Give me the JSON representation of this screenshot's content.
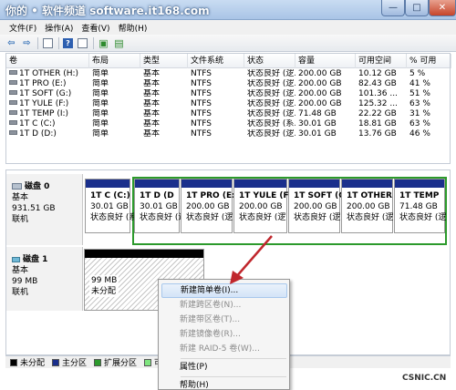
{
  "window": {
    "title": "你的 • 软件频道 software.it168.com",
    "minimize_glyph": "—",
    "maximize_glyph": "□",
    "close_glyph": "✕"
  },
  "menubar": [
    {
      "label": "文件(F)"
    },
    {
      "label": "操作(A)"
    },
    {
      "label": "查看(V)"
    },
    {
      "label": "帮助(H)"
    }
  ],
  "toolbar": {
    "icons": [
      "back-arrow-icon",
      "forward-arrow-icon",
      "console-tree-icon",
      "help-icon",
      "properties-icon",
      "refresh-icon",
      "export-icon"
    ]
  },
  "volume_table": {
    "columns": [
      "卷",
      "布局",
      "类型",
      "文件系统",
      "状态",
      "容量",
      "可用空间",
      "% 可用"
    ],
    "rows": [
      {
        "volume": "1T OTHER (H:)",
        "layout": "简单",
        "type": "基本",
        "fs": "NTFS",
        "status": "状态良好 (逻...",
        "capacity": "200.00 GB",
        "free": "10.12 GB",
        "pct": "5 %"
      },
      {
        "volume": "1T PRO (E:)",
        "layout": "简单",
        "type": "基本",
        "fs": "NTFS",
        "status": "状态良好 (逻...",
        "capacity": "200.00 GB",
        "free": "82.43 GB",
        "pct": "41 %"
      },
      {
        "volume": "1T SOFT (G:)",
        "layout": "简单",
        "type": "基本",
        "fs": "NTFS",
        "status": "状态良好 (逻...",
        "capacity": "200.00 GB",
        "free": "101.36 ...",
        "pct": "51 %"
      },
      {
        "volume": "1T YULE (F:)",
        "layout": "简单",
        "type": "基本",
        "fs": "NTFS",
        "status": "状态良好 (逻...",
        "capacity": "200.00 GB",
        "free": "125.32 ...",
        "pct": "63 %"
      },
      {
        "volume": "1T TEMP (I:)",
        "layout": "简单",
        "type": "基本",
        "fs": "NTFS",
        "status": "状态良好 (逻...",
        "capacity": "71.48 GB",
        "free": "22.22 GB",
        "pct": "31 %"
      },
      {
        "volume": "1T C (C:)",
        "layout": "简单",
        "type": "基本",
        "fs": "NTFS",
        "status": "状态良好 (系...",
        "capacity": "30.01 GB",
        "free": "18.81 GB",
        "pct": "63 %"
      },
      {
        "volume": "1T D (D:)",
        "layout": "简单",
        "type": "基本",
        "fs": "NTFS",
        "status": "状态良好 (逻...",
        "capacity": "30.01 GB",
        "free": "13.76 GB",
        "pct": "46 %"
      }
    ]
  },
  "disks": [
    {
      "name": "磁盘 0",
      "type": "基本",
      "size": "931.51 GB",
      "status": "联机"
    },
    {
      "name": "磁盘 1",
      "type": "基本",
      "size": "99 MB",
      "status": "联机"
    }
  ],
  "partitions": {
    "disk0": [
      {
        "name": "1T C  (C:)",
        "size": "30.01 GB",
        "status": "状态良好 (系"
      },
      {
        "name": "1T D  (D",
        "size": "30.01 GB",
        "status": "状态良好 (逻"
      },
      {
        "name": "1T PRO  (E:",
        "size": "200.00 GB",
        "status": "状态良好 (逻"
      },
      {
        "name": "1T YULE  (F:",
        "size": "200.00 GB",
        "status": "状态良好 (逻"
      },
      {
        "name": "1T SOFT  (G",
        "size": "200.00 GB",
        "status": "状态良好 (逻"
      },
      {
        "name": "1T OTHER",
        "size": "200.00 GB",
        "status": "状态良好 (逻"
      },
      {
        "name": "1T TEMP",
        "size": "71.48 GB",
        "status": "状态良好 (逻"
      }
    ],
    "disk1": [
      {
        "size": "99 MB",
        "status": "未分配"
      }
    ]
  },
  "legend": [
    {
      "label": "未分配",
      "color": "#000000"
    },
    {
      "label": "主分区",
      "color": "#1a2f8c"
    },
    {
      "label": "扩展分区",
      "color": "#2c9a2c"
    },
    {
      "label": "可用",
      "color": "#7fe57f"
    }
  ],
  "context_menu": {
    "items": [
      {
        "label": "新建简单卷(I)...",
        "enabled": true
      },
      {
        "label": "新建跨区卷(N)...",
        "enabled": false
      },
      {
        "label": "新建带区卷(T)...",
        "enabled": false
      },
      {
        "label": "新建镜像卷(R)...",
        "enabled": false
      },
      {
        "label": "新建 RAID-5 卷(W)...",
        "enabled": false
      },
      {
        "label": "属性(P)",
        "enabled": true
      },
      {
        "label": "帮助(H)",
        "enabled": true
      }
    ]
  },
  "watermark": "CSNIC.CN",
  "colors": {
    "primary_partition_bar": "#1a2f8c",
    "unallocated_bar": "#000000",
    "extended_outline": "#2c9a2c",
    "annotation_arrow": "#c0272d"
  }
}
